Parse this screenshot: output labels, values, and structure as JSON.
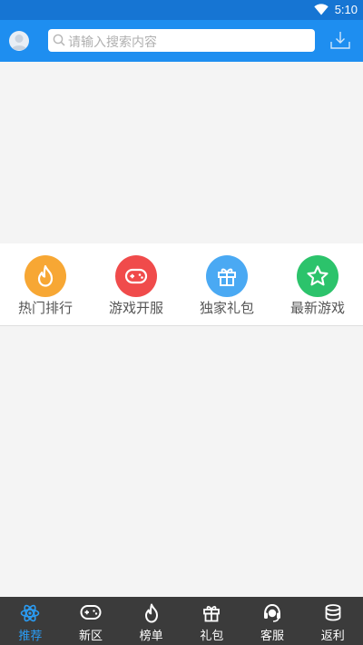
{
  "status_bar": {
    "time": "5:10"
  },
  "search": {
    "placeholder": "请输入搜索内容"
  },
  "quick_menu": [
    {
      "label": "热门排行",
      "icon": "flame-icon",
      "color": "#f7a734"
    },
    {
      "label": "游戏开服",
      "icon": "gamepad-icon",
      "color": "#f04b4b"
    },
    {
      "label": "独家礼包",
      "icon": "gift-icon",
      "color": "#4aa9f3"
    },
    {
      "label": "最新游戏",
      "icon": "star-icon",
      "color": "#2cc36b"
    }
  ],
  "tabs": [
    {
      "label": "推荐",
      "icon": "atom-icon",
      "active": true
    },
    {
      "label": "新区",
      "icon": "gamepad-icon",
      "active": false
    },
    {
      "label": "榜单",
      "icon": "flame-icon",
      "active": false
    },
    {
      "label": "礼包",
      "icon": "gift-icon",
      "active": false
    },
    {
      "label": "客服",
      "icon": "headset-icon",
      "active": false
    },
    {
      "label": "返利",
      "icon": "coins-icon",
      "active": false
    }
  ],
  "colors": {
    "primary": "#1e8ef0",
    "status_bar": "#1675d3",
    "tab_bar": "#3b3b3b",
    "tab_active": "#2a9cf4"
  }
}
